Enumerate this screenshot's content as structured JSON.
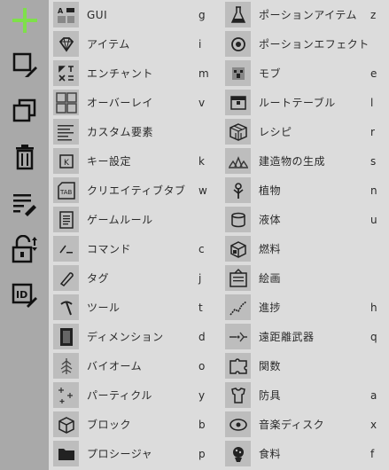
{
  "toolbar": {
    "items": [
      {
        "name": "add-icon"
      },
      {
        "name": "edit-frame-icon"
      },
      {
        "name": "duplicate-icon"
      },
      {
        "name": "trash-icon"
      },
      {
        "name": "edit-list-icon"
      },
      {
        "name": "unlock-sort-icon"
      },
      {
        "name": "edit-id-icon"
      }
    ]
  },
  "left_categories": [
    {
      "label": "GUI",
      "key": "g",
      "icon": "gui-icon"
    },
    {
      "label": "アイテム",
      "key": "i",
      "icon": "diamond-icon"
    },
    {
      "label": "エンチャント",
      "key": "m",
      "icon": "enchant-icon"
    },
    {
      "label": "オーバーレイ",
      "key": "v",
      "icon": "overlay-grid-icon"
    },
    {
      "label": "カスタム要素",
      "key": "",
      "icon": "text-lines-icon"
    },
    {
      "label": "キー設定",
      "key": "k",
      "icon": "key-icon"
    },
    {
      "label": "クリエイティブタブ",
      "key": "w",
      "icon": "tab-icon"
    },
    {
      "label": "ゲームルール",
      "key": "",
      "icon": "document-icon"
    },
    {
      "label": "コマンド",
      "key": "c",
      "icon": "command-icon"
    },
    {
      "label": "タグ",
      "key": "j",
      "icon": "tag-icon"
    },
    {
      "label": "ツール",
      "key": "t",
      "icon": "pickaxe-icon"
    },
    {
      "label": "ディメンション",
      "key": "d",
      "icon": "portal-icon"
    },
    {
      "label": "バイオーム",
      "key": "o",
      "icon": "tree-icon"
    },
    {
      "label": "パーティクル",
      "key": "y",
      "icon": "particle-icon"
    },
    {
      "label": "ブロック",
      "key": "b",
      "icon": "cube-icon"
    },
    {
      "label": "プロシージャ",
      "key": "p",
      "icon": "folder-icon"
    }
  ],
  "right_categories": [
    {
      "label": "ポーションアイテム",
      "key": "z",
      "icon": "potion-flask-icon"
    },
    {
      "label": "ポーションエフェクト",
      "key": "",
      "icon": "potion-effect-icon"
    },
    {
      "label": "モブ",
      "key": "e",
      "icon": "mob-face-icon"
    },
    {
      "label": "ルートテーブル",
      "key": "l",
      "icon": "loot-table-icon"
    },
    {
      "label": "レシピ",
      "key": "r",
      "icon": "recipe-box-icon"
    },
    {
      "label": "建造物の生成",
      "key": "s",
      "icon": "structure-icon"
    },
    {
      "label": "植物",
      "key": "n",
      "icon": "plant-icon"
    },
    {
      "label": "液体",
      "key": "u",
      "icon": "bucket-icon"
    },
    {
      "label": "燃料",
      "key": "",
      "icon": "fuel-icon"
    },
    {
      "label": "絵画",
      "key": "",
      "icon": "painting-icon"
    },
    {
      "label": "進捗",
      "key": "h",
      "icon": "progress-chart-icon"
    },
    {
      "label": "遠距離武器",
      "key": "q",
      "icon": "ranged-weapon-icon"
    },
    {
      "label": "関数",
      "key": "",
      "icon": "function-puzzle-icon"
    },
    {
      "label": "防具",
      "key": "a",
      "icon": "armor-icon"
    },
    {
      "label": "音楽ディスク",
      "key": "x",
      "icon": "music-disc-icon"
    },
    {
      "label": "食料",
      "key": "f",
      "icon": "food-icon"
    }
  ]
}
